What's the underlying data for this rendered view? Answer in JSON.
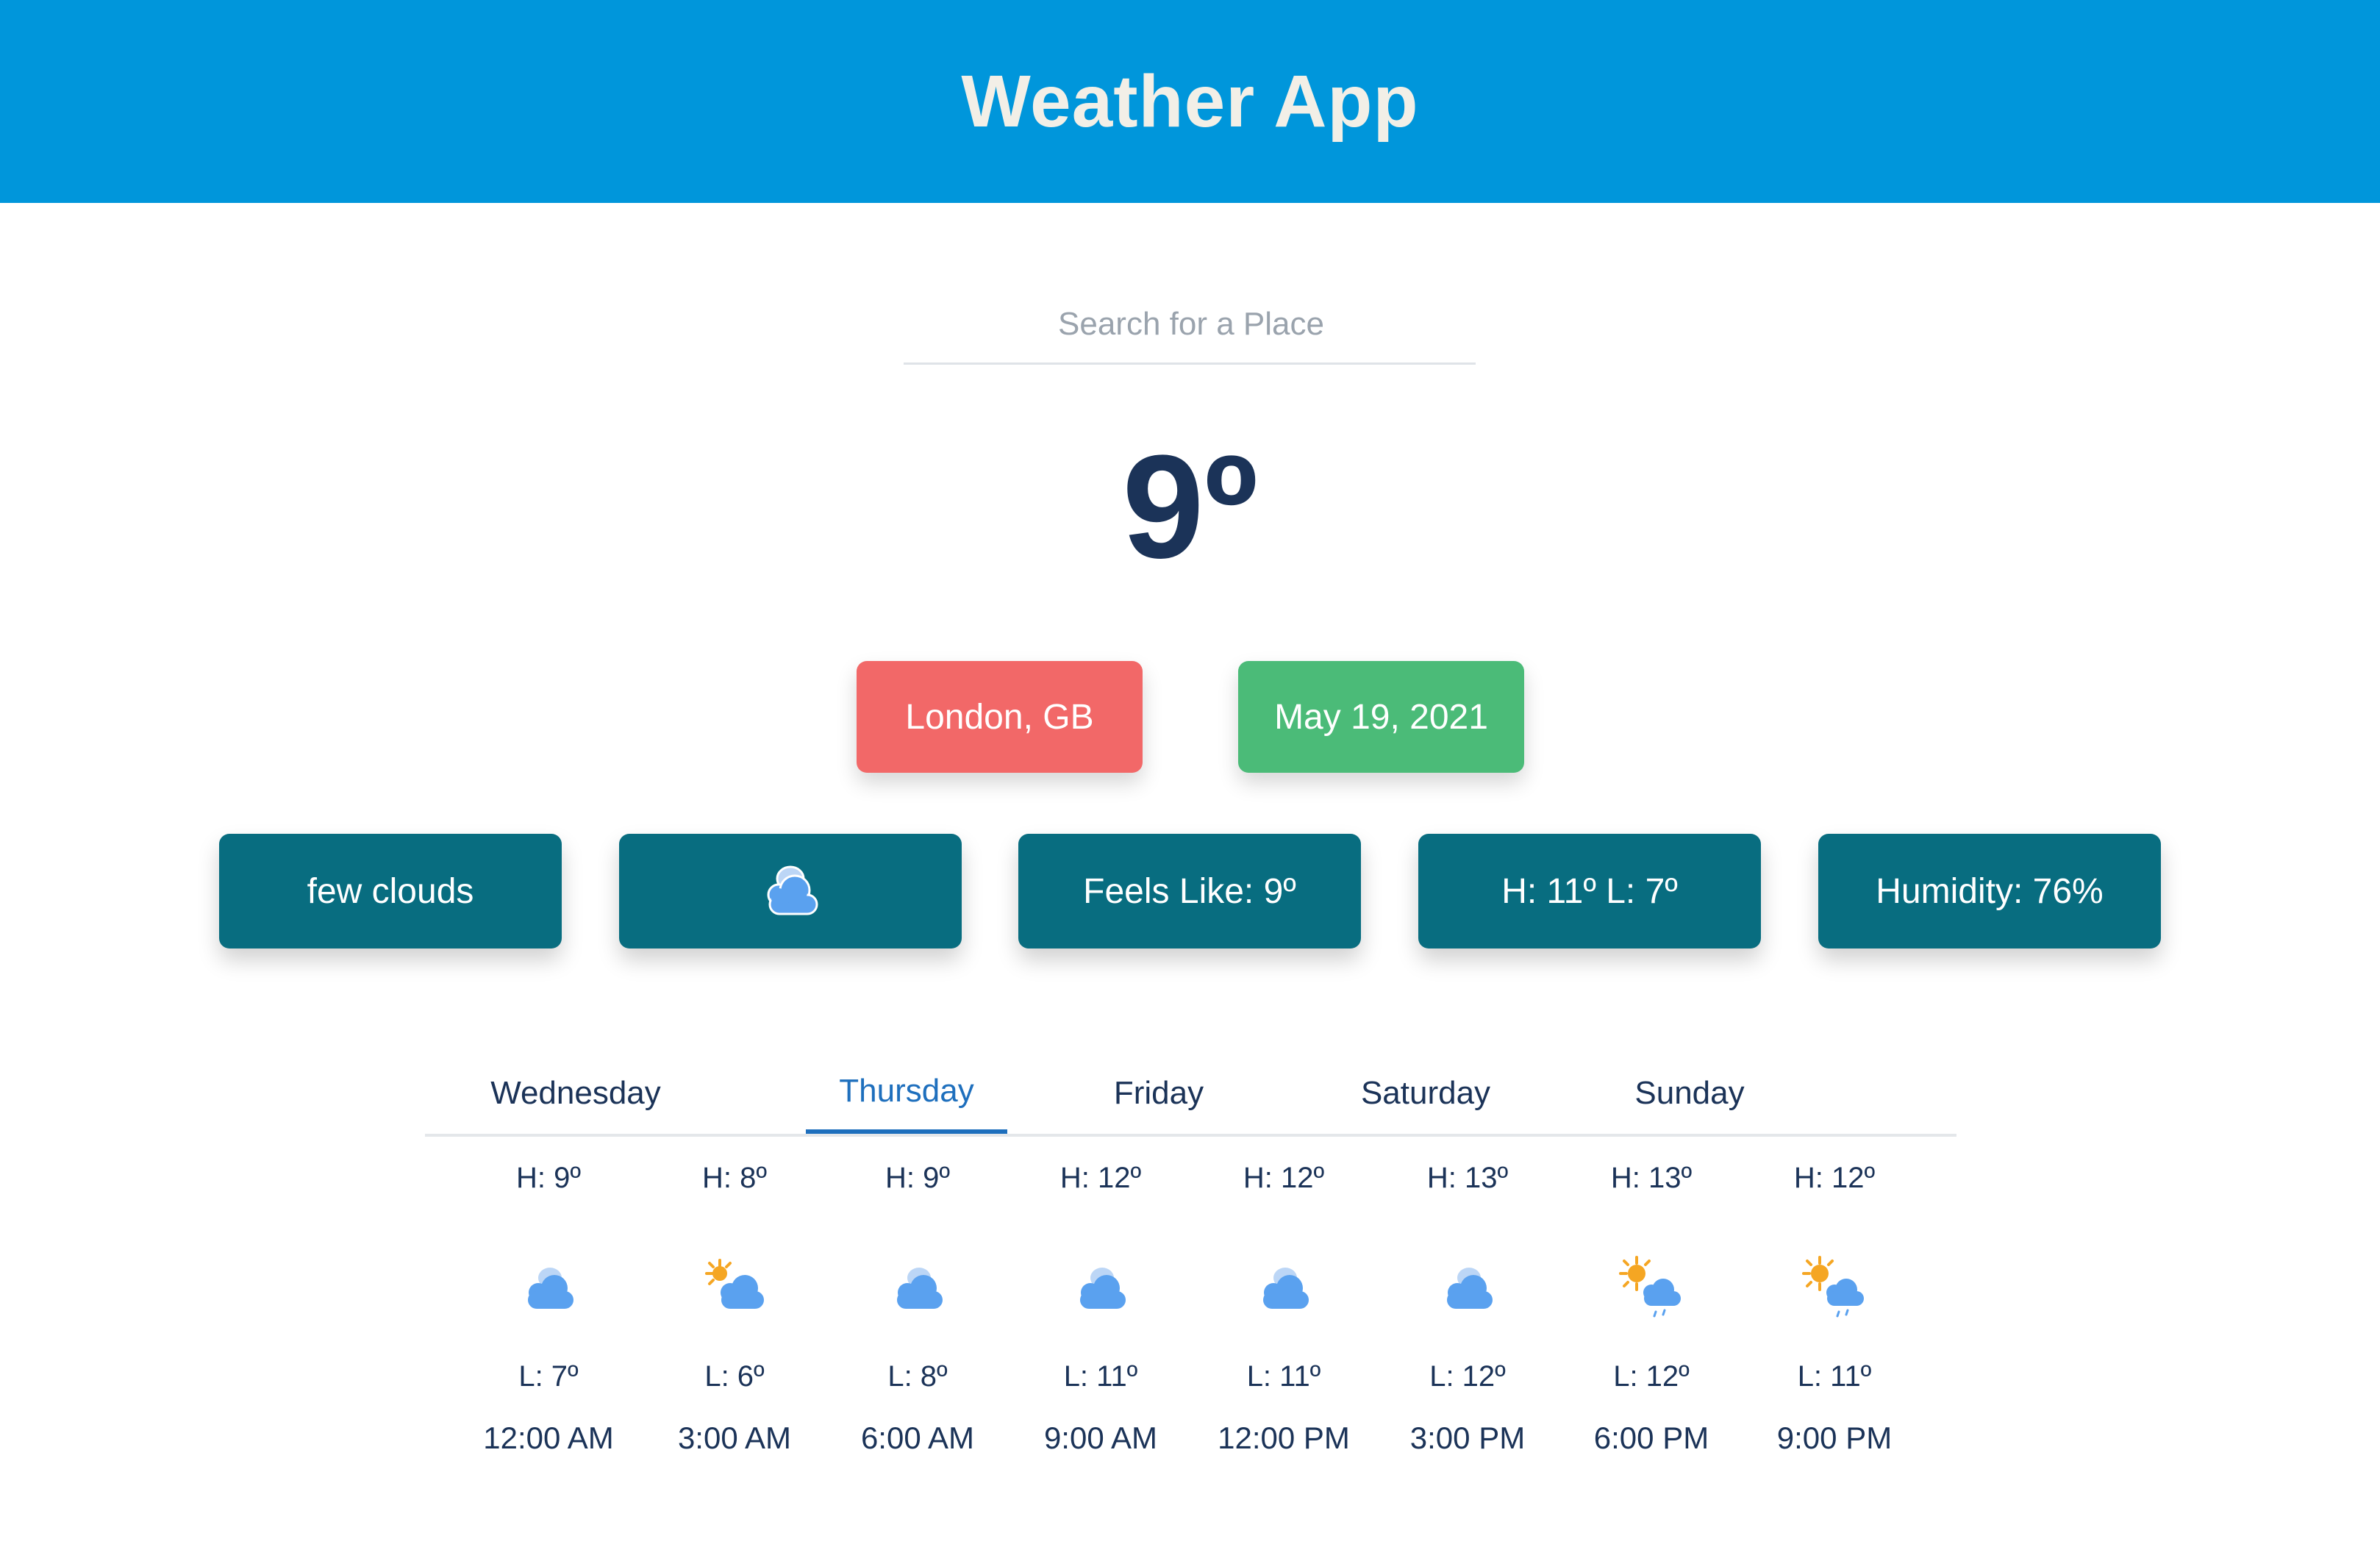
{
  "header": {
    "title": "Weather App"
  },
  "search": {
    "placeholder": "Search for a Place",
    "value": ""
  },
  "current": {
    "temperature": "9º",
    "location": "London, GB",
    "date": "May 19, 2021",
    "description": "few clouds",
    "icon": "cloud-icon",
    "feels_like": "Feels Like: 9º",
    "high_low": "H: 11º L: 7º",
    "humidity": "Humidity: 76%"
  },
  "colors": {
    "header": "#0096db",
    "location_pill": "#f26868",
    "date_pill": "#4bbb78",
    "info_card": "#086d80",
    "active_tab": "#1e6fbd",
    "text": "#1b3358"
  },
  "tabs": [
    {
      "label": "Wednesday",
      "active": false
    },
    {
      "label": "Thursday",
      "active": true
    },
    {
      "label": "Friday",
      "active": false
    },
    {
      "label": "Saturday",
      "active": false
    },
    {
      "label": "Sunday",
      "active": false
    }
  ],
  "hourly": [
    {
      "high": "H: 9º",
      "low": "L: 7º",
      "time": "12:00 AM",
      "icon": "cloud-icon"
    },
    {
      "high": "H: 8º",
      "low": "L: 6º",
      "time": "3:00 AM",
      "icon": "sun-cloud-icon"
    },
    {
      "high": "H: 9º",
      "low": "L: 8º",
      "time": "6:00 AM",
      "icon": "cloud-icon"
    },
    {
      "high": "H: 12º",
      "low": "L: 11º",
      "time": "9:00 AM",
      "icon": "cloud-icon"
    },
    {
      "high": "H: 12º",
      "low": "L: 11º",
      "time": "12:00 PM",
      "icon": "cloud-icon"
    },
    {
      "high": "H: 13º",
      "low": "L: 12º",
      "time": "3:00 PM",
      "icon": "cloud-icon"
    },
    {
      "high": "H: 13º",
      "low": "L: 12º",
      "time": "6:00 PM",
      "icon": "sun-rain-icon"
    },
    {
      "high": "H: 12º",
      "low": "L: 11º",
      "time": "9:00 PM",
      "icon": "sun-rain-icon"
    }
  ]
}
